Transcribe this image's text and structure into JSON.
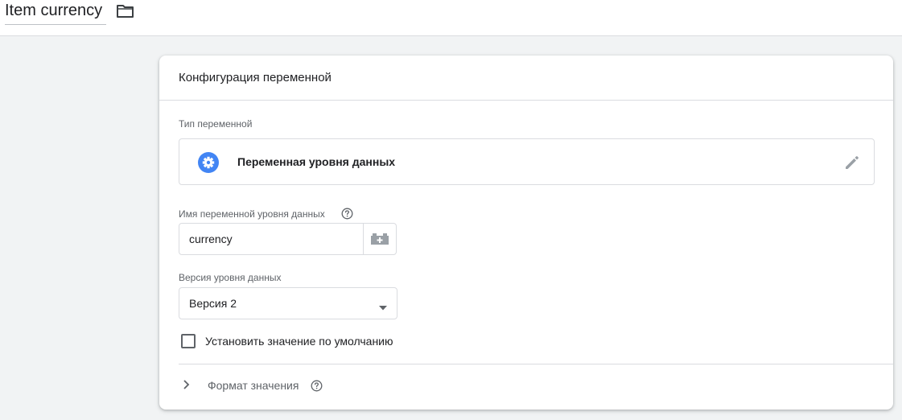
{
  "header": {
    "variable_name": "Item currency",
    "folder_icon": "folder-icon"
  },
  "card": {
    "title": "Конфигурация переменной",
    "variable_type": {
      "label": "Тип переменной",
      "value": "Переменная уровня данных",
      "icon": "gear-icon",
      "accent": "#4285f4",
      "edit_icon": "pencil-icon"
    },
    "datalayer_name": {
      "label": "Имя переменной уровня данных",
      "value": "currency",
      "help_icon": "help-icon",
      "picker_icon": "variable-picker-icon"
    },
    "datalayer_version": {
      "label": "Версия уровня данных",
      "selected": "Версия 2"
    },
    "default_value": {
      "label": "Установить значение по умолчанию",
      "checked": false
    },
    "format_value": {
      "label": "Формат значения",
      "icon": "chevron-right-icon"
    }
  }
}
